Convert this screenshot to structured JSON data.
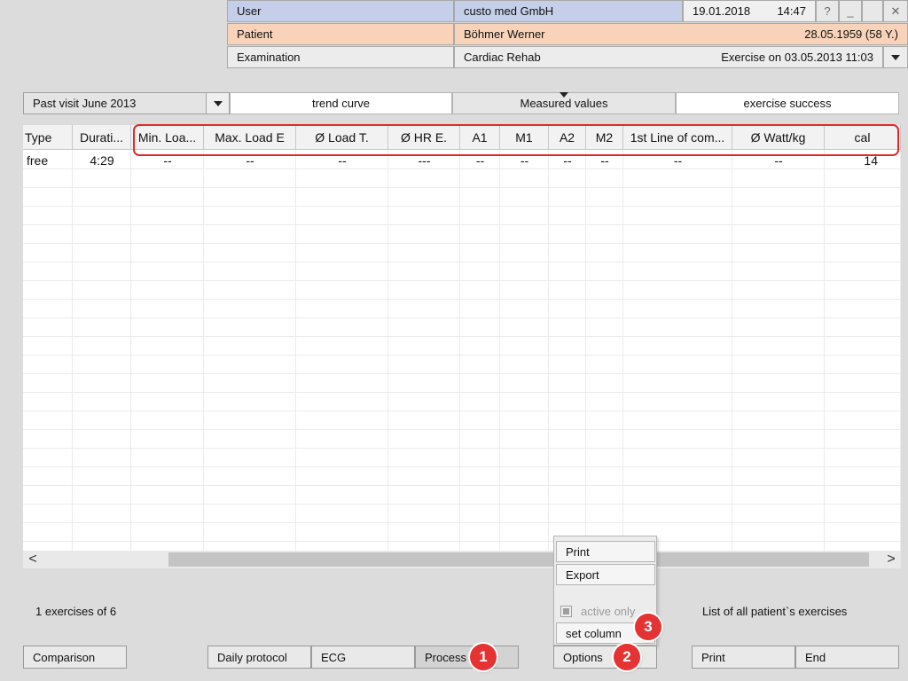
{
  "header": {
    "user_label": "User",
    "user_value": "custo med GmbH",
    "date": "19.01.2018",
    "time": "14:47",
    "help_symbol": "?",
    "minimize_symbol": "_",
    "close_symbol": "✕",
    "patient_label": "Patient",
    "patient_name": "Böhmer Werner",
    "patient_dob": "28.05.1959 (58 Y.)",
    "exam_label": "Examination",
    "exam_type": "Cardiac Rehab",
    "exam_detail": "Exercise on 03.05.2013 11:03"
  },
  "colors": {
    "user_row": "#c5cfe9",
    "patient_row": "#f8d3b9",
    "highlight": "#e02a2a",
    "badge": "#e53232"
  },
  "visit_select": {
    "value": "Past visit June 2013"
  },
  "tabs": [
    {
      "label": "trend curve"
    },
    {
      "label": "Measured values",
      "active": true
    },
    {
      "label": "exercise success"
    }
  ],
  "table": {
    "columns": [
      "Type",
      "Durati...",
      "Min. Loa...",
      "Max. Load E",
      "Ø Load T.",
      "Ø HR E.",
      "A1",
      "M1",
      "A2",
      "M2",
      "1st Line of com...",
      "Ø Watt/kg",
      "cal"
    ],
    "rows": [
      [
        "free",
        "4:29",
        "--",
        "--",
        "--",
        "---",
        "--",
        "--",
        "--",
        "--",
        "--",
        "--",
        "14"
      ]
    ]
  },
  "scroll": {
    "left_arrow": "<",
    "right_arrow": ">"
  },
  "status": {
    "count_text": "1 exercises of 6",
    "list_text": "List of all patient`s exercises"
  },
  "popup_menu": {
    "print": "Print",
    "export": "Export",
    "active_only": "active only",
    "set_column": "set column"
  },
  "buttons": {
    "comparison": "Comparison",
    "daily_protocol": "Daily protocol",
    "ecg": "ECG",
    "process": "Process",
    "options": "Options",
    "print": "Print",
    "end": "End"
  },
  "badges": [
    "1",
    "2",
    "3"
  ]
}
